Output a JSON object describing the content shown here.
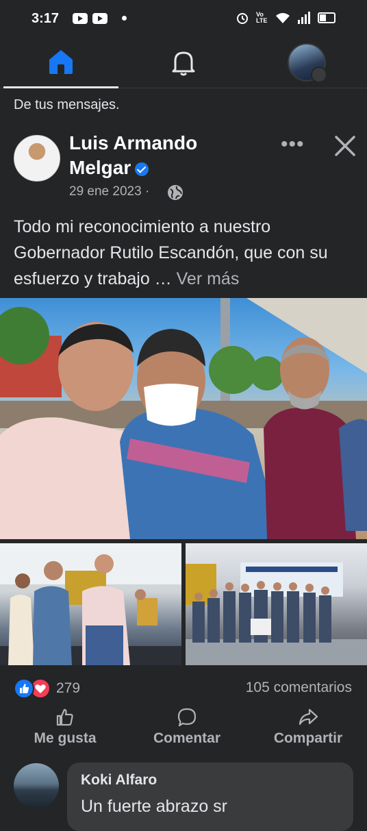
{
  "status_bar": {
    "time": "3:17",
    "signal_label": "Vo LTE"
  },
  "nav": {
    "home_label": "",
    "home_color": "#1877f2"
  },
  "feed": {
    "section_label": "De tus mensajes."
  },
  "post": {
    "author": "Luis Armando Melgar",
    "verified": true,
    "date": "29 ene 2023",
    "date_separator": "·",
    "privacy_icon": "globe-icon",
    "text": "Todo mi reconocimiento a nuestro Gobernador Rutilo Escandón, que con su esfuerzo y trabajo …",
    "see_more": "Ver más",
    "reaction_count": "279",
    "comment_count": "105 comentarios",
    "actions": {
      "like": "Me gusta",
      "comment": "Comentar",
      "share": "Compartir"
    }
  },
  "comment": {
    "author": "Koki Alfaro",
    "text": "Un fuerte abrazo sr"
  },
  "colors": {
    "background": "#242526",
    "text": "#e4e6eb",
    "secondary": "#b0b3b8",
    "like_blue": "#1877f2",
    "love_red": "#f33e58"
  }
}
